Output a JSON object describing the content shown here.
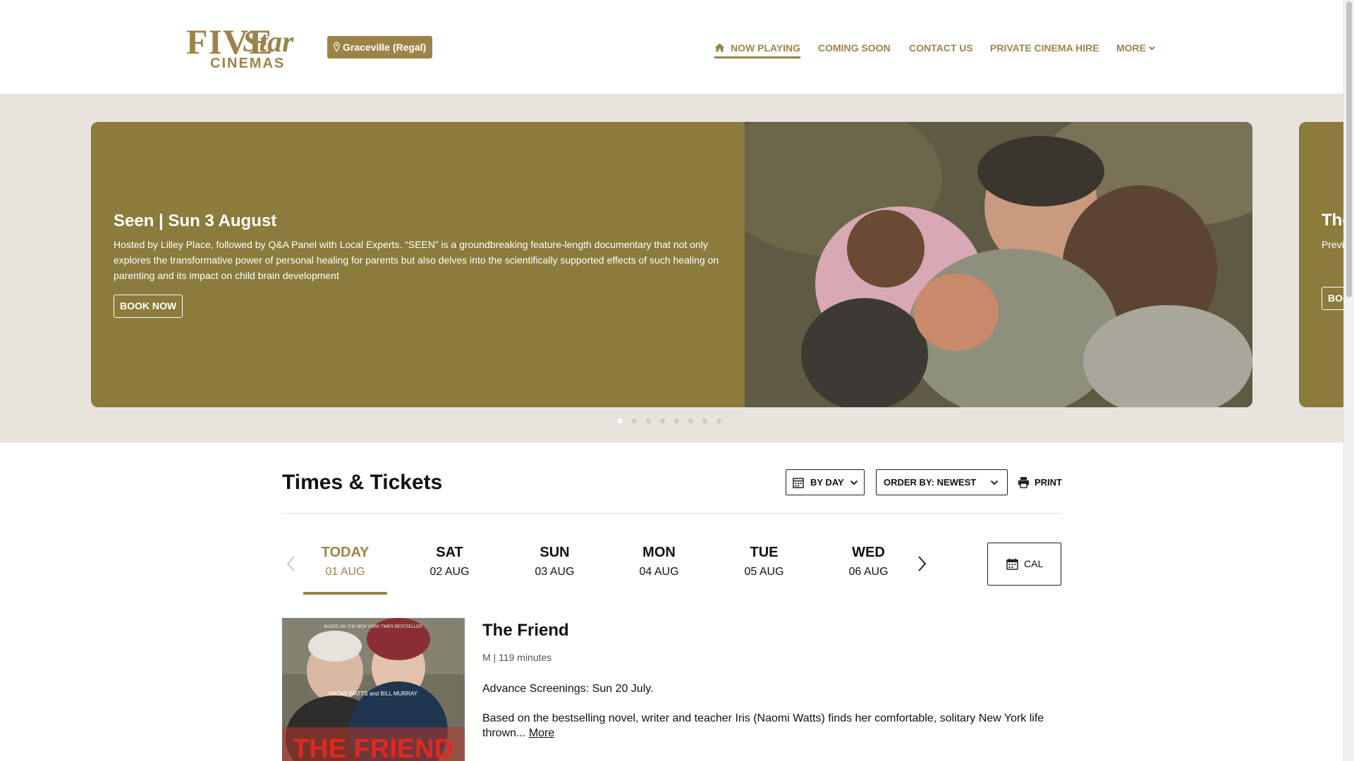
{
  "brand": {
    "logo_top": "FIVE",
    "logo_star": "Star",
    "logo_bottom": "CINEMAS",
    "color": "#9c8448"
  },
  "location": {
    "label": "Graceville (Regal)",
    "icon": "map-pin-icon"
  },
  "nav": {
    "items": [
      {
        "label": "NOW PLAYING",
        "icon": "home-icon",
        "active": true
      },
      {
        "label": "COMING SOON"
      },
      {
        "label": "CONTACT US"
      },
      {
        "label": "PRIVATE CINEMA HIRE"
      },
      {
        "label": "MORE",
        "icon": "chevron-down-icon"
      }
    ]
  },
  "hero": {
    "slide": {
      "title": "Seen | Sun 3 August",
      "description": "Hosted by Lilley Place, followed by Q&A Panel with Local Experts. “SEEN” is a groundbreaking feature-length documentary that not only explores the transformative power of personal healing for parents but also delves into the scientifically supported effects of such healing on parenting and its impact on child brain development",
      "button": "BOOK NOW"
    },
    "next_slide": {
      "title": "The",
      "description": "Previ man",
      "button": "BOOK NOW"
    },
    "dot_count": 8,
    "active_dot": 0,
    "colors": {
      "slide_bg": "#8b7b3c",
      "hero_bg": "#e8e4dd"
    }
  },
  "times": {
    "title": "Times & Tickets",
    "by_day_label": "BY DAY",
    "order_label": "ORDER BY: NEWEST",
    "print_label": "PRINT",
    "cal_label": "CAL",
    "dates": [
      {
        "day": "TODAY",
        "date": "01 AUG",
        "active": true
      },
      {
        "day": "SAT",
        "date": "02 AUG"
      },
      {
        "day": "SUN",
        "date": "03 AUG"
      },
      {
        "day": "MON",
        "date": "04 AUG"
      },
      {
        "day": "TUE",
        "date": "05 AUG"
      },
      {
        "day": "WED",
        "date": "06 AUG"
      }
    ]
  },
  "movie": {
    "title": "The Friend",
    "meta": "M | 119 minutes",
    "advance": "Advance Screenings: Sun 20 July.",
    "synopsis": "Based on the bestselling novel, writer and teacher Iris (Naomi Watts) finds her comfortable, solitary New York life thrown...",
    "more_label": "More",
    "poster": {
      "top_text": "BASED ON THE NEW YORK TIMES BESTSELLER",
      "cast": "NAOMI WATTS and BILL MURRAY",
      "title": "THE FRIEND"
    }
  }
}
